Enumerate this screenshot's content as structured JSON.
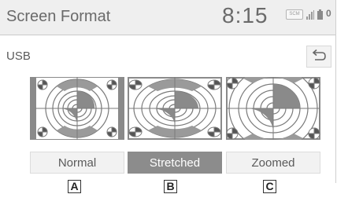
{
  "header": {
    "title": "Screen Format",
    "clock": "8:15",
    "source_badge": "SCM",
    "notification_count": "0"
  },
  "source_label": "USB",
  "back_icon": "return-arrow-icon",
  "modes": [
    {
      "label": "Normal",
      "selected": false,
      "callout": "A"
    },
    {
      "label": "Stretched",
      "selected": true,
      "callout": "B"
    },
    {
      "label": "Zoomed",
      "selected": false,
      "callout": "C"
    }
  ],
  "colors": {
    "header_bg": "#efefef",
    "selected_button": "#8c8c8c",
    "button_bg": "#f2f2f2",
    "pattern_gray": "#888888"
  }
}
